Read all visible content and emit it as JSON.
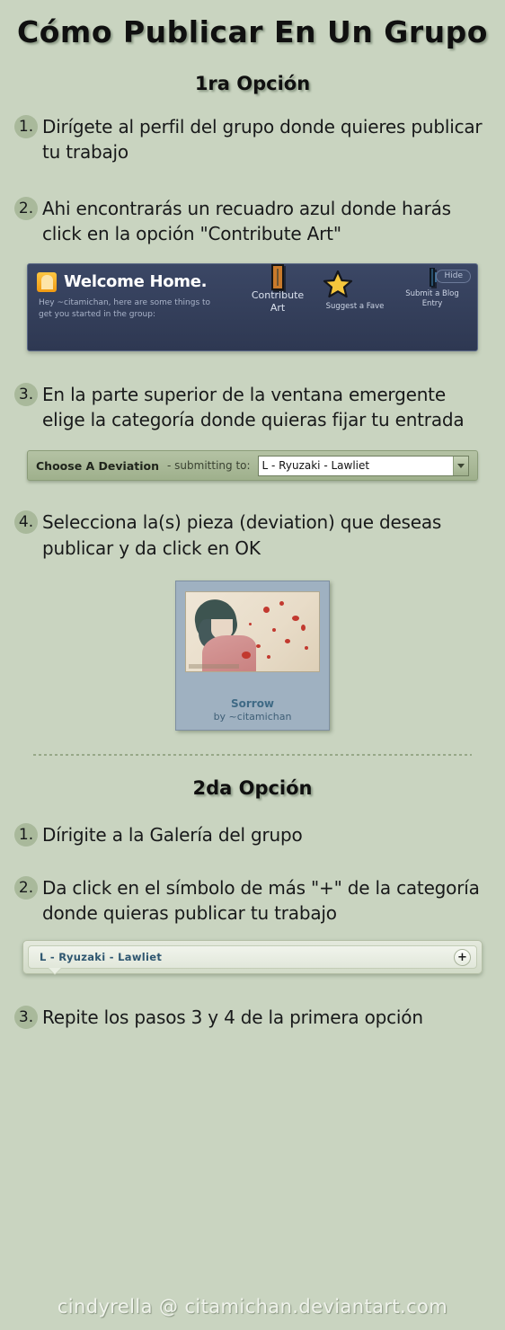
{
  "theme": {
    "background": "#c9d4c0",
    "bullet": "#a9b99b",
    "heading_text": "#101010",
    "panel_blue": "#3b4765",
    "accent_link": "#2e5670"
  },
  "title": "Cómo Publicar En Un Grupo",
  "option1": {
    "heading": "1ra Opción",
    "steps": [
      {
        "num": "1.",
        "text": "Dirígete al perfil del grupo donde quieres publicar tu trabajo"
      },
      {
        "num": "2.",
        "text": "Ahi encontrarás un recuadro azul donde harás click en la opción \"Contribute Art\""
      },
      {
        "num": "3.",
        "text": "En la parte superior de la ventana emergente elige la categoría donde quieras fijar tu entrada"
      },
      {
        "num": "4.",
        "text": "Selecciona la(s) pieza (deviation) que deseas publicar y da click en OK"
      }
    ]
  },
  "welcome_widget": {
    "home_icon": "home-icon",
    "title": "Welcome Home.",
    "subtitle": "Hey ~citamichan, here are some things to get you started in the group:",
    "hide_label": "Hide",
    "actions": [
      {
        "icon": "framed-picture-icon",
        "label": "Contribute Art"
      },
      {
        "icon": "star-icon",
        "label": "Suggest a Fave"
      },
      {
        "icon": "blog-book-icon",
        "label": "Submit a Blog Entry"
      }
    ]
  },
  "choose_deviation_bar": {
    "label": "Choose A Deviation",
    "submitting_to_label": "- submitting to:",
    "selected_option": "L - Ryuzaki - Lawliet",
    "dropdown_icon": "chevron-down-icon"
  },
  "deviation_thumb": {
    "title": "Sorrow",
    "by": "by ~citamichan"
  },
  "option2": {
    "heading": "2da Opción",
    "steps": [
      {
        "num": "1.",
        "text": "Dírigite a la Galería del grupo"
      },
      {
        "num": "2.",
        "text": "Da click en el símbolo de más \"+\" de la categoría donde quieras publicar tu trabajo"
      },
      {
        "num": "3.",
        "text": "Repite los pasos 3 y 4 de la primera opción"
      }
    ]
  },
  "gallery_folder_bar": {
    "folder_name": "L - Ryuzaki - Lawliet",
    "add_label": "+"
  },
  "footer": "cindyrella @ citamichan.deviantart.com"
}
